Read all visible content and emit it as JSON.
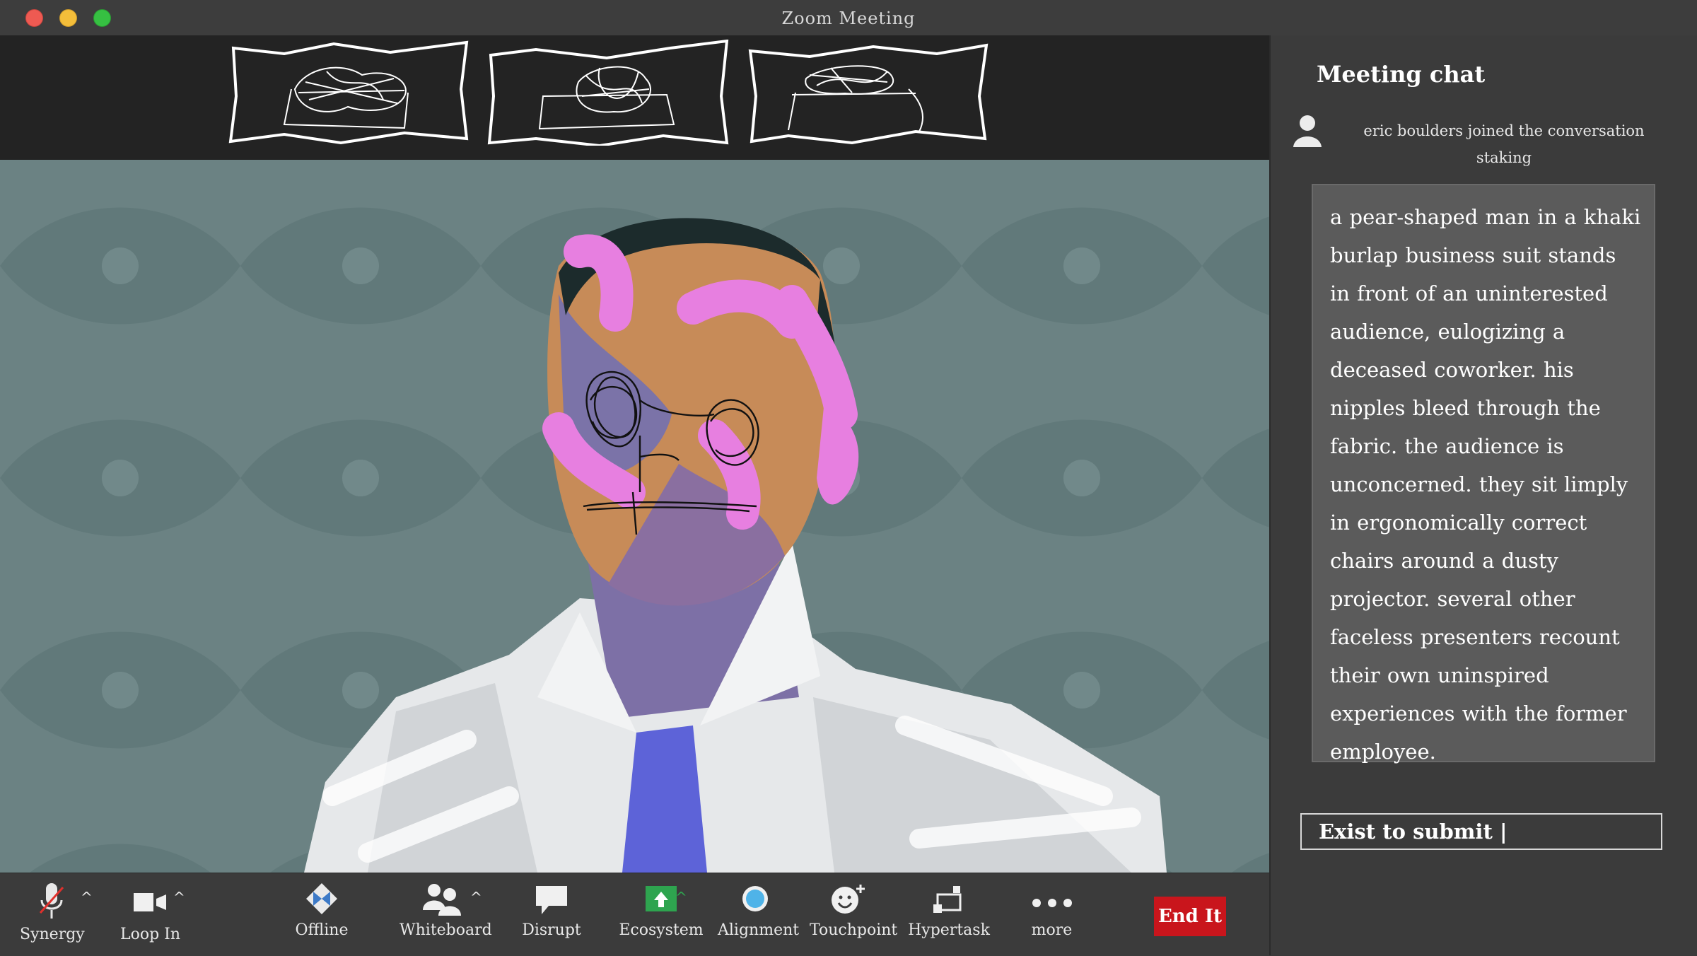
{
  "window": {
    "title": "Zoom Meeting"
  },
  "thumbnails": [
    {
      "name": "participant-thumbnail-1"
    },
    {
      "name": "participant-thumbnail-2"
    },
    {
      "name": "participant-thumbnail-3"
    }
  ],
  "chat": {
    "title": "Meeting chat",
    "system_message": "eric boulders joined the conversation staking",
    "message": "a pear-shaped man in a khaki burlap business suit stands in front of an uninterested audience, eulogizing a deceased coworker. his nipples bleed through the fabric. the audience is unconcerned. they sit limply in ergonomically correct chairs around a dusty projector. several other faceless presenters recount their own uninspired experiences with the former employee.",
    "input_value": "Exist to submit |"
  },
  "toolbar": {
    "synergy": "Synergy",
    "loop_in": "Loop In",
    "offline": "Offline",
    "whiteboard": "Whiteboard",
    "disrupt": "Disrupt",
    "ecosystem": "Ecosystem",
    "alignment": "Alignment",
    "touchpoint": "Touchpoint",
    "hypertask": "Hypertask",
    "more": "more",
    "end": "End It",
    "caret": "^"
  },
  "colors": {
    "end_button": "#c9151c",
    "ecosystem_icon": "#2ea44f",
    "video_background": "#6b8283",
    "chat_panel": "#3b3b3b"
  }
}
